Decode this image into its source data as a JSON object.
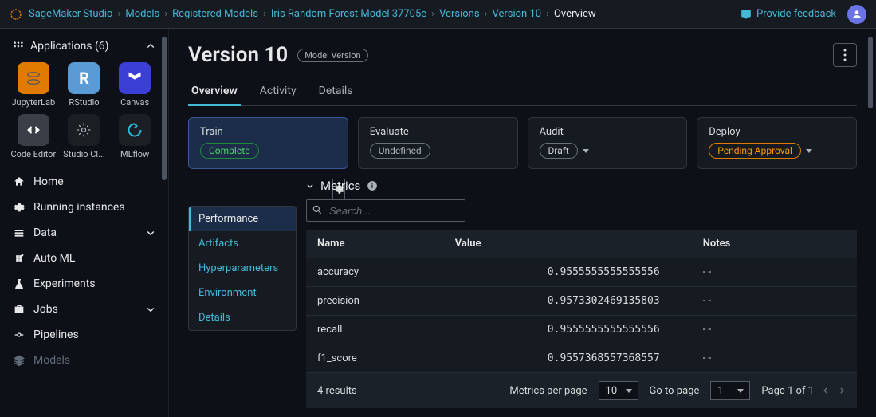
{
  "breadcrumb": {
    "items": [
      {
        "label": "SageMaker Studio"
      },
      {
        "label": "Models"
      },
      {
        "label": "Registered Models"
      },
      {
        "label": "Iris Random Forest Model 37705e"
      },
      {
        "label": "Versions"
      },
      {
        "label": "Version 10"
      },
      {
        "label": "Overview",
        "active": true
      }
    ],
    "feedback": "Provide feedback"
  },
  "sidebar": {
    "apps_header": "Applications (6)",
    "apps": [
      {
        "label": "JupyterLab",
        "bg": "#e07b00",
        "icon": "jupyter"
      },
      {
        "label": "RStudio",
        "bg": "#5a9bd5",
        "icon": "rstudio"
      },
      {
        "label": "Canvas",
        "bg": "#3b3fd6",
        "icon": "canvas"
      },
      {
        "label": "Code Editor",
        "bg": "#3a3f47",
        "icon": "code"
      },
      {
        "label": "Studio Cl...",
        "bg": "#1b1f24",
        "icon": "cog"
      },
      {
        "label": "MLflow",
        "bg": "#1b1f24",
        "icon": "mlflow"
      }
    ],
    "nav": [
      {
        "label": "Home",
        "icon": "home",
        "expandable": false
      },
      {
        "label": "Running instances",
        "icon": "gear",
        "expandable": false
      },
      {
        "label": "Data",
        "icon": "stack",
        "expandable": true
      },
      {
        "label": "Auto ML",
        "icon": "automl",
        "expandable": false
      },
      {
        "label": "Experiments",
        "icon": "flask",
        "expandable": false
      },
      {
        "label": "Jobs",
        "icon": "briefcase",
        "expandable": true
      },
      {
        "label": "Pipelines",
        "icon": "pipeline",
        "expandable": false
      },
      {
        "label": "Models",
        "icon": "layers",
        "expandable": false,
        "dim": true
      }
    ]
  },
  "page": {
    "title": "Version 10",
    "badge": "Model Version",
    "tabs": [
      {
        "label": "Overview",
        "active": true
      },
      {
        "label": "Activity"
      },
      {
        "label": "Details"
      }
    ],
    "stages": [
      {
        "title": "Train",
        "status": "Complete",
        "pill": "pill-complete",
        "highlighted": true,
        "dropdown": false
      },
      {
        "title": "Evaluate",
        "status": "Undefined",
        "pill": "pill-undefined",
        "dropdown": false
      },
      {
        "title": "Audit",
        "status": "Draft",
        "pill": "pill-draft",
        "dropdown": true
      },
      {
        "title": "Deploy",
        "status": "Pending Approval",
        "pill": "pill-pending",
        "dropdown": true
      }
    ],
    "subtabs": [
      {
        "label": "Performance",
        "active": true
      },
      {
        "label": "Artifacts"
      },
      {
        "label": "Hyperparameters"
      },
      {
        "label": "Environment"
      },
      {
        "label": "Details"
      }
    ],
    "metrics_section": "Metrics",
    "search_placeholder": "Search...",
    "table": {
      "headers": [
        "Name",
        "Value",
        "Notes"
      ],
      "rows": [
        {
          "name": "accuracy",
          "value": "0.9555555555555556",
          "notes": "- -"
        },
        {
          "name": "precision",
          "value": "0.9573302469135803",
          "notes": "- -"
        },
        {
          "name": "recall",
          "value": "0.9555555555555556",
          "notes": "- -"
        },
        {
          "name": "f1_score",
          "value": "0.9557368557368557",
          "notes": "- -"
        }
      ]
    },
    "pager": {
      "results_count": "4 results",
      "per_page_label": "Metrics per page",
      "per_page_value": "10",
      "goto_label": "Go to page",
      "goto_value": "1",
      "page_info": "Page 1 of 1"
    }
  }
}
